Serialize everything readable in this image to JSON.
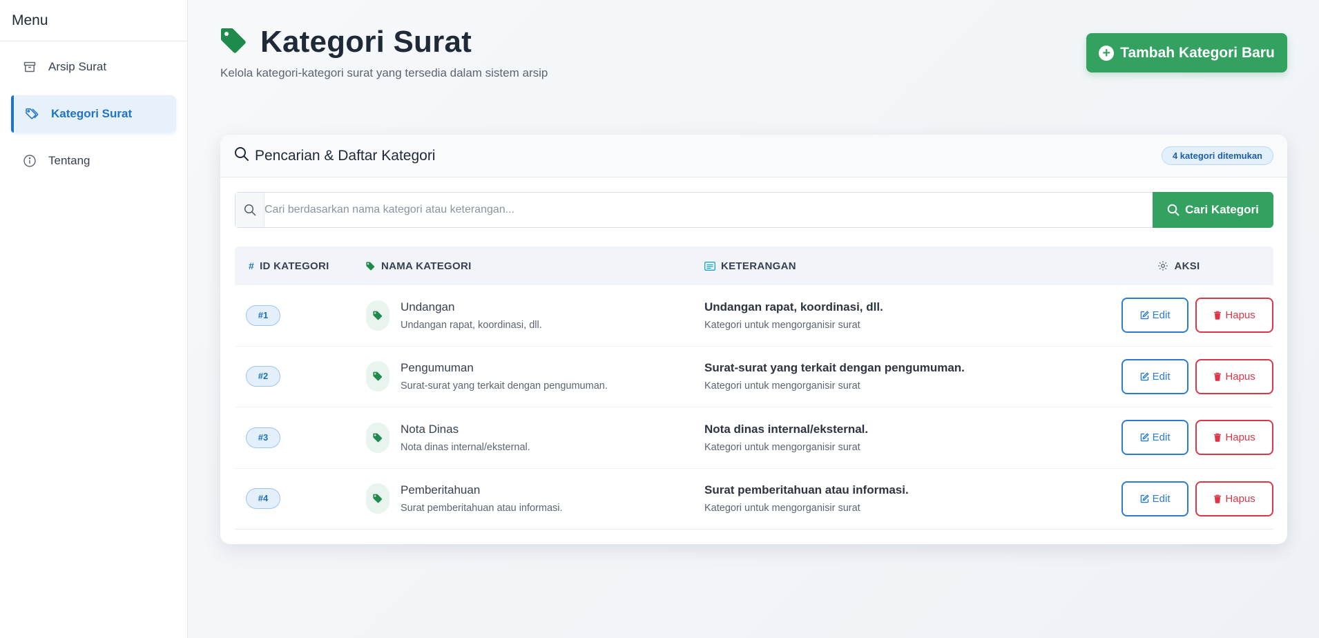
{
  "sidebar": {
    "title": "Menu",
    "items": [
      {
        "label": "Arsip Surat",
        "icon": "archive-icon",
        "active": false
      },
      {
        "label": "Kategori Surat",
        "icon": "tags-icon",
        "active": true
      },
      {
        "label": "Tentang",
        "icon": "info-icon",
        "active": false
      }
    ]
  },
  "header": {
    "title": "Kategori Surat",
    "subtitle": "Kelola kategori-kategori surat yang tersedia dalam sistem arsip",
    "add_button": "Tambah Kategori Baru"
  },
  "card": {
    "title": "Pencarian & Daftar Kategori",
    "count_badge": "4 kategori ditemukan",
    "search": {
      "placeholder": "Cari berdasarkan nama kategori atau keterangan...",
      "value": "",
      "button": "Cari Kategori"
    }
  },
  "table": {
    "columns": {
      "id": "ID KATEGORI",
      "name": "NAMA KATEGORI",
      "ket": "KETERANGAN",
      "aksi": "AKSI"
    },
    "rows": [
      {
        "id": "#1",
        "name": "Undangan",
        "name_sub": "Undangan rapat, koordinasi, dll.",
        "ket": "Undangan rapat, koordinasi, dll.",
        "ket_sub": "Kategori untuk mengorganisir surat",
        "edit": "Edit",
        "hapus": "Hapus"
      },
      {
        "id": "#2",
        "name": "Pengumuman",
        "name_sub": "Surat-surat yang terkait dengan pengumuman.",
        "ket": "Surat-surat yang terkait dengan pengumuman.",
        "ket_sub": "Kategori untuk mengorganisir surat",
        "edit": "Edit",
        "hapus": "Hapus"
      },
      {
        "id": "#3",
        "name": "Nota Dinas",
        "name_sub": "Nota dinas internal/eksternal.",
        "ket": "Nota dinas internal/eksternal.",
        "ket_sub": "Kategori untuk mengorganisir surat",
        "edit": "Edit",
        "hapus": "Hapus"
      },
      {
        "id": "#4",
        "name": "Pemberitahuan",
        "name_sub": "Surat pemberitahuan atau informasi.",
        "ket": "Surat pemberitahuan atau informasi.",
        "ket_sub": "Kategori untuk mengorganisir surat",
        "edit": "Edit",
        "hapus": "Hapus"
      }
    ]
  },
  "colors": {
    "primary_green": "#33a160",
    "primary_blue": "#1f74c7",
    "danger_red": "#dc3545",
    "tag_green": "#1e8a4c",
    "info_cyan": "#17a2c8"
  }
}
